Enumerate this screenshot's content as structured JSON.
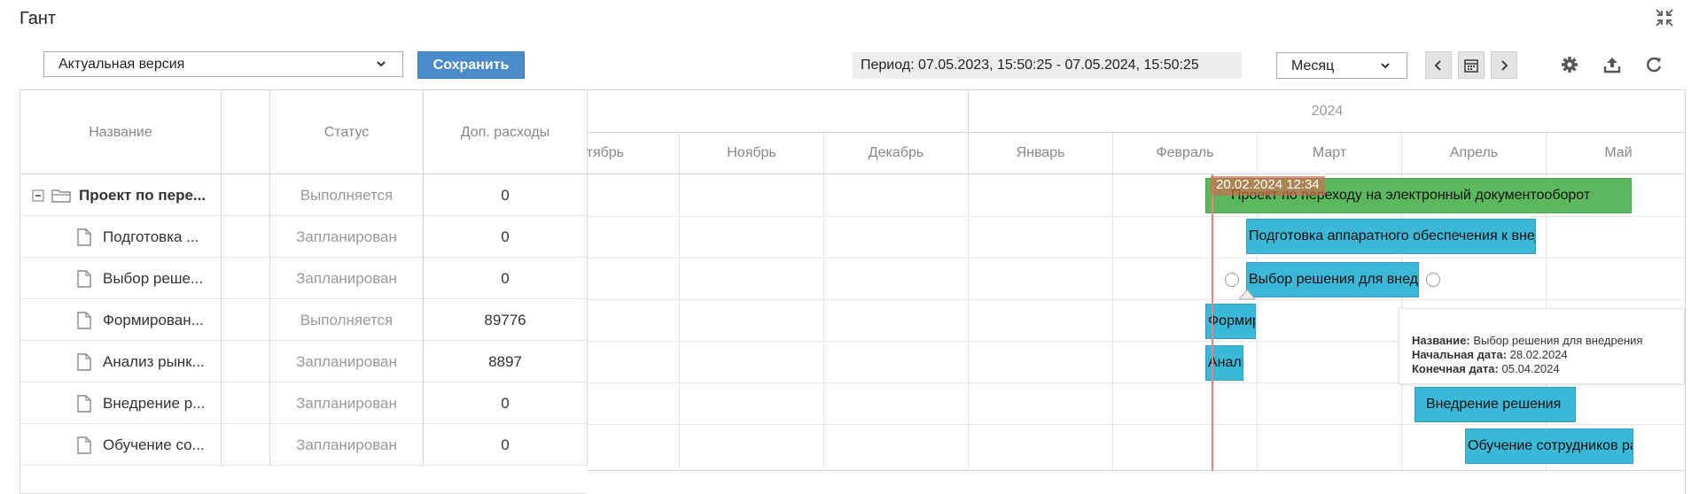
{
  "page": {
    "title": "Гант"
  },
  "toolbar": {
    "version_select": "Актуальная версия",
    "save_label": "Сохранить",
    "period_label": "Период: ",
    "period_value": "07.05.2023, 15:50:25 - 07.05.2024, 15:50:25",
    "scale_select": "Месяц",
    "icons": [
      "chevron-left-icon",
      "calendar-icon",
      "chevron-right-icon",
      "gear-icon",
      "export-icon",
      "refresh-icon",
      "collapse-icon"
    ]
  },
  "grid": {
    "columns": [
      "Название",
      "",
      "Статус",
      "Доп. расходы"
    ],
    "rows": [
      {
        "name": "Проект по пере...",
        "status": "Выполняется",
        "cost": "0",
        "type": "folder"
      },
      {
        "name": "Подготовка ...",
        "status": "Запланирован",
        "cost": "0",
        "type": "file"
      },
      {
        "name": "Выбор реше...",
        "status": "Запланирован",
        "cost": "0",
        "type": "file"
      },
      {
        "name": "Формирован...",
        "status": "Выполняется",
        "cost": "89776",
        "type": "file"
      },
      {
        "name": "Анализ рынк...",
        "status": "Запланирован",
        "cost": "8897",
        "type": "file"
      },
      {
        "name": "Внедрение р...",
        "status": "Запланирован",
        "cost": "0",
        "type": "file"
      },
      {
        "name": "Обучение со...",
        "status": "Запланирован",
        "cost": "0",
        "type": "file"
      }
    ]
  },
  "chart": {
    "year": "2024",
    "months": [
      "Октябрь",
      "Ноябрь",
      "Декабрь",
      "Январь",
      "Февраль",
      "Март",
      "Апрель",
      "Май"
    ],
    "today_label": "20.02.2024 12:34",
    "bars": [
      {
        "label": "Проект по переходу на электронный документооборот",
        "color": "#5cb85c"
      },
      {
        "label": "Подготовка аппаратного обеспечения к внедрению",
        "color": "#3bb8d6"
      },
      {
        "label": "Выбор решения для внедрения",
        "color": "#3bb8d6"
      },
      {
        "label": "Формирование",
        "color": "#3bb8d6"
      },
      {
        "label": "Анализ рынка",
        "color": "#3bb8d6"
      },
      {
        "label": "Внедрение решения",
        "color": "#3bb8d6"
      },
      {
        "label": "Обучение сотрудников работе",
        "color": "#3bb8d6"
      }
    ]
  },
  "tooltip": {
    "name_label": "Название:",
    "name_value": "Выбор решения для внедрения",
    "start_label": "Начальная дата:",
    "start_value": "28.02.2024",
    "end_label": "Конечная дата:",
    "end_value": "05.04.2024"
  }
}
